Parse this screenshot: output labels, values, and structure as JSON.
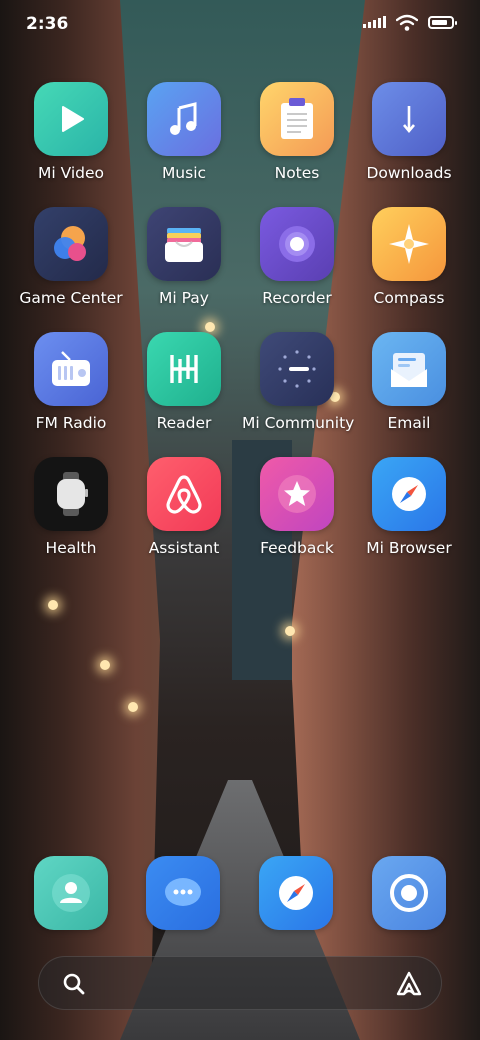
{
  "status_bar": {
    "time": "2:36",
    "battery_level": 0.85
  },
  "apps": [
    {
      "label": "Mi Video",
      "icon": "play-icon"
    },
    {
      "label": "Music",
      "icon": "music-note-icon"
    },
    {
      "label": "Notes",
      "icon": "notepad-icon"
    },
    {
      "label": "Downloads",
      "icon": "download-arrow-icon"
    },
    {
      "label": "Game Center",
      "icon": "game-bubbles-icon"
    },
    {
      "label": "Mi Pay",
      "icon": "wallet-icon"
    },
    {
      "label": "Recorder",
      "icon": "record-circle-icon"
    },
    {
      "label": "Compass",
      "icon": "compass-star-icon"
    },
    {
      "label": "FM Radio",
      "icon": "radio-icon"
    },
    {
      "label": "Reader",
      "icon": "book-h-icon"
    },
    {
      "label": "Mi Community",
      "icon": "community-dial-icon"
    },
    {
      "label": "Email",
      "icon": "envelope-icon"
    },
    {
      "label": "Health",
      "icon": "watch-icon"
    },
    {
      "label": "Assistant",
      "icon": "airbnb-logo-icon"
    },
    {
      "label": "Feedback",
      "icon": "star-icon"
    },
    {
      "label": "Mi Browser",
      "icon": "compass-needle-icon"
    }
  ],
  "dock": [
    {
      "icon": "contacts-person-icon"
    },
    {
      "icon": "messages-bubble-icon"
    },
    {
      "icon": "browser-needle-icon"
    },
    {
      "icon": "camera-lens-icon"
    }
  ],
  "colors": {
    "mi_video": "#3cc9b0",
    "music": "#4c8fe6",
    "notes": "#f7b45c",
    "downloads": "#5a74d6",
    "mi_pay": "#3a3f66",
    "recorder": "#6a4fc7",
    "compass": "#f5a44c",
    "fm_radio": "#5b7fe0",
    "reader": "#2ec9a4",
    "mi_community": "#3a4470",
    "email": "#5aa6ea",
    "health": "#111111",
    "assistant": "#ff4a5e",
    "feedback": "#e04aa0",
    "mi_browser": "#2e8ff0"
  }
}
